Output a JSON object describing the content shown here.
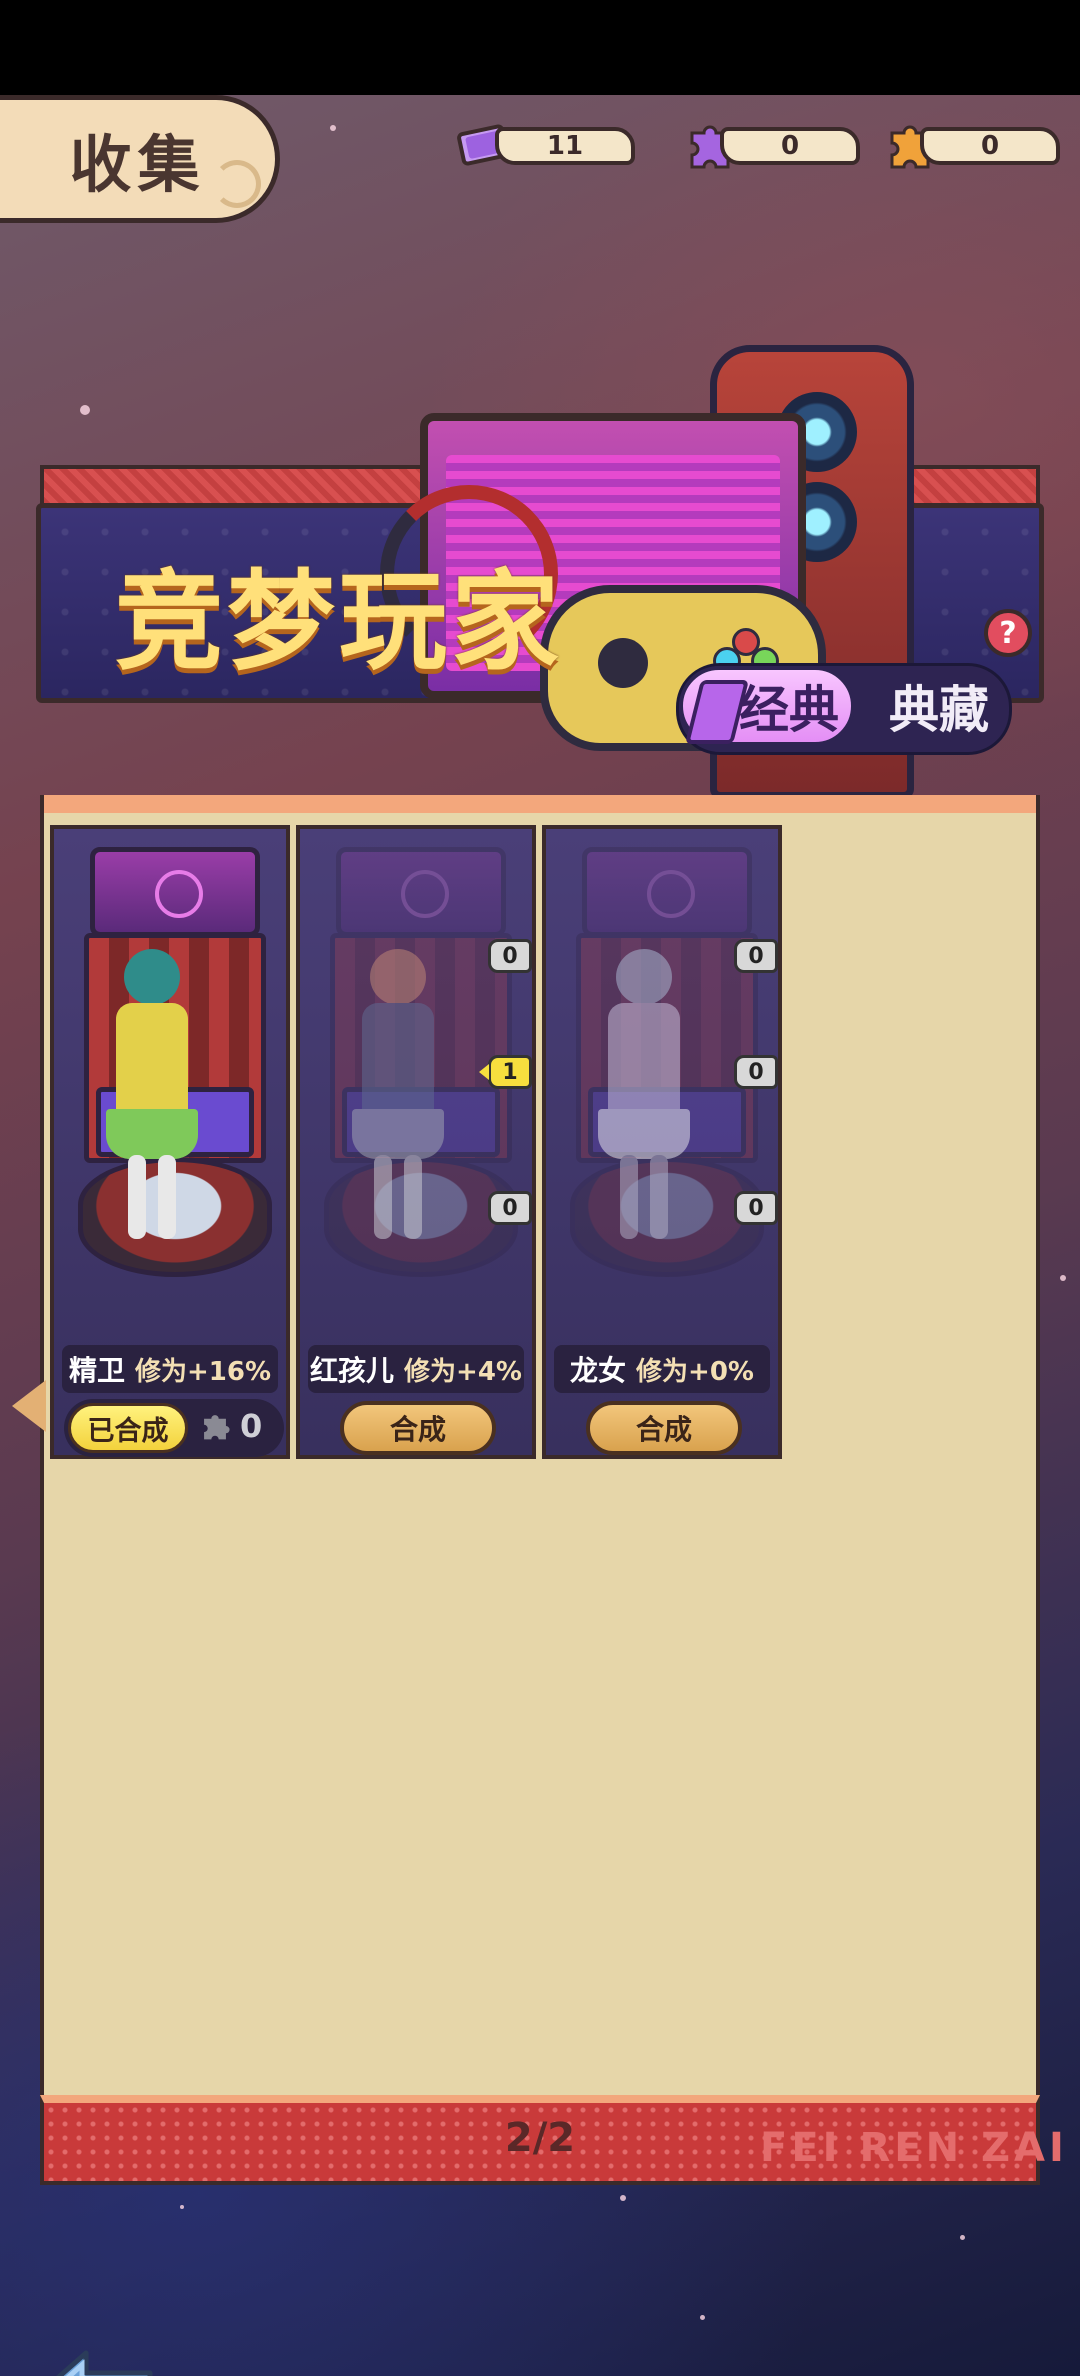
{
  "header": {
    "title": "收集"
  },
  "currencies": [
    {
      "icon": "ticket-icon",
      "value": "11",
      "color": "#b67fe6"
    },
    {
      "icon": "purple-puzzle-icon",
      "value": "0",
      "color": "#9b5ad8"
    },
    {
      "icon": "orange-puzzle-icon",
      "value": "0",
      "color": "#f0a23a"
    }
  ],
  "banner": {
    "title": "竞梦玩家",
    "tabs": {
      "classic": "经典",
      "collection": "典藏"
    },
    "help": "?"
  },
  "cards": [
    {
      "name": "精卫",
      "bonus": "修为+16%",
      "status": "owned",
      "button": "已合成",
      "fragments": "0",
      "badges": []
    },
    {
      "name": "红孩儿",
      "bonus": "修为+4%",
      "status": "locked",
      "button": "合成",
      "badges": [
        "0",
        "1",
        "0"
      ]
    },
    {
      "name": "龙女",
      "bonus": "修为+0%",
      "status": "locked",
      "button": "合成",
      "badges": [
        "0",
        "0",
        "0"
      ]
    }
  ],
  "pagination": {
    "page": "2/2"
  },
  "footer": {
    "watermark": "FEI REN ZAI"
  },
  "colors": {
    "panel_bg": "#e6d6a9",
    "card_bg": "#3f3668",
    "compose_button": "#e8b564",
    "owned_button": "#f7e35a",
    "banner_title": "#ffe07a"
  }
}
